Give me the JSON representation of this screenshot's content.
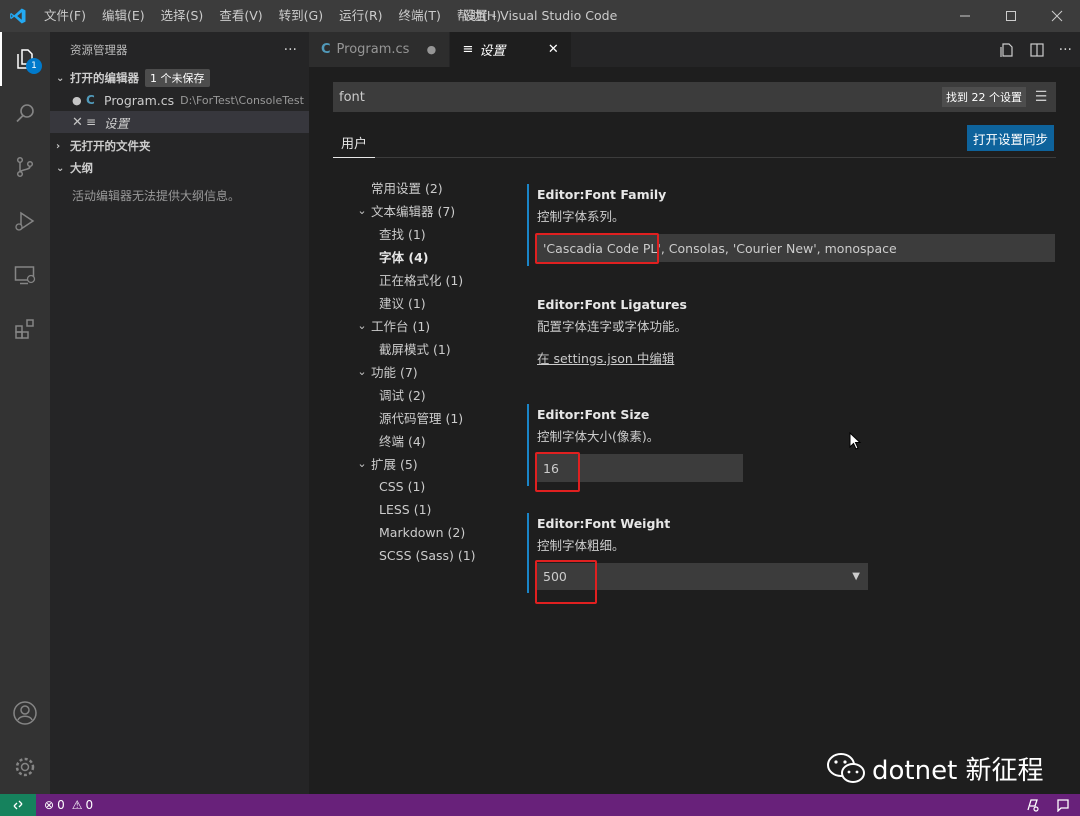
{
  "titlebar": {
    "window_title": "设置 - Visual Studio Code",
    "menu": [
      "文件(F)",
      "编辑(E)",
      "选择(S)",
      "查看(V)",
      "转到(G)",
      "运行(R)",
      "终端(T)",
      "帮助(H)"
    ]
  },
  "activity": {
    "explorer_badge": "1"
  },
  "sidebar": {
    "title": "资源管理器",
    "more": "···",
    "open_editors": {
      "label": "打开的编辑器",
      "unsaved": "1 个未保存"
    },
    "editors": [
      {
        "name": "Program.cs",
        "path": "D:\\ForTest\\ConsoleTest"
      },
      {
        "name": "设置"
      }
    ],
    "no_folder": "无打开的文件夹",
    "outline": {
      "label": "大纲",
      "message": "活动编辑器无法提供大纲信息。"
    }
  },
  "tabs": [
    {
      "label": "Program.cs",
      "icon": "C"
    },
    {
      "label": "设置",
      "icon": "≡"
    }
  ],
  "settings": {
    "search_value": "font",
    "found_count": "找到 22 个设置",
    "scope_tab": "用户",
    "sync_button": "打开设置同步",
    "toc": [
      {
        "label": "常用设置 (2)",
        "level": 0,
        "chevron": ""
      },
      {
        "label": "文本编辑器 (7)",
        "level": 0,
        "chevron": "⌄"
      },
      {
        "label": "查找 (1)",
        "level": 1,
        "chevron": ""
      },
      {
        "label": "字体 (4)",
        "level": 1,
        "chevron": ""
      },
      {
        "label": "正在格式化 (1)",
        "level": 1,
        "chevron": ""
      },
      {
        "label": "建议 (1)",
        "level": 1,
        "chevron": ""
      },
      {
        "label": "工作台 (1)",
        "level": 0,
        "chevron": "⌄"
      },
      {
        "label": "截屏模式 (1)",
        "level": 1,
        "chevron": ""
      },
      {
        "label": "功能 (7)",
        "level": 0,
        "chevron": "⌄"
      },
      {
        "label": "调试 (2)",
        "level": 1,
        "chevron": ""
      },
      {
        "label": "源代码管理 (1)",
        "level": 1,
        "chevron": ""
      },
      {
        "label": "终端 (4)",
        "level": 1,
        "chevron": ""
      },
      {
        "label": "扩展 (5)",
        "level": 0,
        "chevron": "⌄"
      },
      {
        "label": "CSS (1)",
        "level": 1,
        "chevron": ""
      },
      {
        "label": "LESS (1)",
        "level": 1,
        "chevron": ""
      },
      {
        "label": "Markdown (2)",
        "level": 1,
        "chevron": ""
      },
      {
        "label": "SCSS (Sass) (1)",
        "level": 1,
        "chevron": ""
      }
    ],
    "font_family": {
      "category": "Editor: ",
      "name": "Font Family",
      "desc": "控制字体系列。",
      "value": "'Cascadia Code PL', Consolas, 'Courier New', monospace"
    },
    "font_ligatures": {
      "category": "Editor: ",
      "name": "Font Ligatures",
      "desc": "配置字体连字或字体功能。",
      "link": "在 settings.json 中编辑"
    },
    "font_size": {
      "category": "Editor: ",
      "name": "Font Size",
      "desc": "控制字体大小(像素)。",
      "value": "16"
    },
    "font_weight": {
      "category": "Editor: ",
      "name": "Font Weight",
      "desc": "控制字体粗细。",
      "value": "500"
    }
  },
  "statusbar": {
    "errors": "0",
    "warnings": "0"
  },
  "watermark": "dotnet 新征程"
}
